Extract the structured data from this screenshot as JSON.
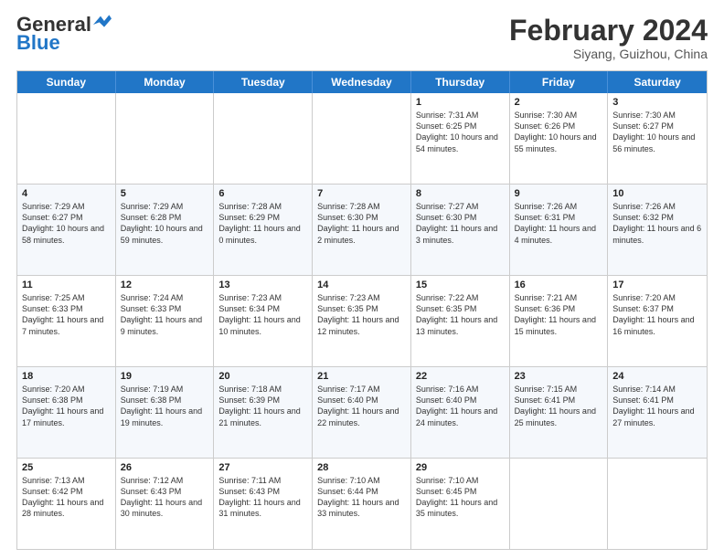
{
  "header": {
    "logo_general": "General",
    "logo_blue": "Blue",
    "month_year": "February 2024",
    "location": "Siyang, Guizhou, China"
  },
  "days_of_week": [
    "Sunday",
    "Monday",
    "Tuesday",
    "Wednesday",
    "Thursday",
    "Friday",
    "Saturday"
  ],
  "weeks": [
    [
      {
        "day": "",
        "info": ""
      },
      {
        "day": "",
        "info": ""
      },
      {
        "day": "",
        "info": ""
      },
      {
        "day": "",
        "info": ""
      },
      {
        "day": "1",
        "info": "Sunrise: 7:31 AM\nSunset: 6:25 PM\nDaylight: 10 hours and 54 minutes."
      },
      {
        "day": "2",
        "info": "Sunrise: 7:30 AM\nSunset: 6:26 PM\nDaylight: 10 hours and 55 minutes."
      },
      {
        "day": "3",
        "info": "Sunrise: 7:30 AM\nSunset: 6:27 PM\nDaylight: 10 hours and 56 minutes."
      }
    ],
    [
      {
        "day": "4",
        "info": "Sunrise: 7:29 AM\nSunset: 6:27 PM\nDaylight: 10 hours and 58 minutes."
      },
      {
        "day": "5",
        "info": "Sunrise: 7:29 AM\nSunset: 6:28 PM\nDaylight: 10 hours and 59 minutes."
      },
      {
        "day": "6",
        "info": "Sunrise: 7:28 AM\nSunset: 6:29 PM\nDaylight: 11 hours and 0 minutes."
      },
      {
        "day": "7",
        "info": "Sunrise: 7:28 AM\nSunset: 6:30 PM\nDaylight: 11 hours and 2 minutes."
      },
      {
        "day": "8",
        "info": "Sunrise: 7:27 AM\nSunset: 6:30 PM\nDaylight: 11 hours and 3 minutes."
      },
      {
        "day": "9",
        "info": "Sunrise: 7:26 AM\nSunset: 6:31 PM\nDaylight: 11 hours and 4 minutes."
      },
      {
        "day": "10",
        "info": "Sunrise: 7:26 AM\nSunset: 6:32 PM\nDaylight: 11 hours and 6 minutes."
      }
    ],
    [
      {
        "day": "11",
        "info": "Sunrise: 7:25 AM\nSunset: 6:33 PM\nDaylight: 11 hours and 7 minutes."
      },
      {
        "day": "12",
        "info": "Sunrise: 7:24 AM\nSunset: 6:33 PM\nDaylight: 11 hours and 9 minutes."
      },
      {
        "day": "13",
        "info": "Sunrise: 7:23 AM\nSunset: 6:34 PM\nDaylight: 11 hours and 10 minutes."
      },
      {
        "day": "14",
        "info": "Sunrise: 7:23 AM\nSunset: 6:35 PM\nDaylight: 11 hours and 12 minutes."
      },
      {
        "day": "15",
        "info": "Sunrise: 7:22 AM\nSunset: 6:35 PM\nDaylight: 11 hours and 13 minutes."
      },
      {
        "day": "16",
        "info": "Sunrise: 7:21 AM\nSunset: 6:36 PM\nDaylight: 11 hours and 15 minutes."
      },
      {
        "day": "17",
        "info": "Sunrise: 7:20 AM\nSunset: 6:37 PM\nDaylight: 11 hours and 16 minutes."
      }
    ],
    [
      {
        "day": "18",
        "info": "Sunrise: 7:20 AM\nSunset: 6:38 PM\nDaylight: 11 hours and 17 minutes."
      },
      {
        "day": "19",
        "info": "Sunrise: 7:19 AM\nSunset: 6:38 PM\nDaylight: 11 hours and 19 minutes."
      },
      {
        "day": "20",
        "info": "Sunrise: 7:18 AM\nSunset: 6:39 PM\nDaylight: 11 hours and 21 minutes."
      },
      {
        "day": "21",
        "info": "Sunrise: 7:17 AM\nSunset: 6:40 PM\nDaylight: 11 hours and 22 minutes."
      },
      {
        "day": "22",
        "info": "Sunrise: 7:16 AM\nSunset: 6:40 PM\nDaylight: 11 hours and 24 minutes."
      },
      {
        "day": "23",
        "info": "Sunrise: 7:15 AM\nSunset: 6:41 PM\nDaylight: 11 hours and 25 minutes."
      },
      {
        "day": "24",
        "info": "Sunrise: 7:14 AM\nSunset: 6:41 PM\nDaylight: 11 hours and 27 minutes."
      }
    ],
    [
      {
        "day": "25",
        "info": "Sunrise: 7:13 AM\nSunset: 6:42 PM\nDaylight: 11 hours and 28 minutes."
      },
      {
        "day": "26",
        "info": "Sunrise: 7:12 AM\nSunset: 6:43 PM\nDaylight: 11 hours and 30 minutes."
      },
      {
        "day": "27",
        "info": "Sunrise: 7:11 AM\nSunset: 6:43 PM\nDaylight: 11 hours and 31 minutes."
      },
      {
        "day": "28",
        "info": "Sunrise: 7:10 AM\nSunset: 6:44 PM\nDaylight: 11 hours and 33 minutes."
      },
      {
        "day": "29",
        "info": "Sunrise: 7:10 AM\nSunset: 6:45 PM\nDaylight: 11 hours and 35 minutes."
      },
      {
        "day": "",
        "info": ""
      },
      {
        "day": "",
        "info": ""
      }
    ]
  ]
}
